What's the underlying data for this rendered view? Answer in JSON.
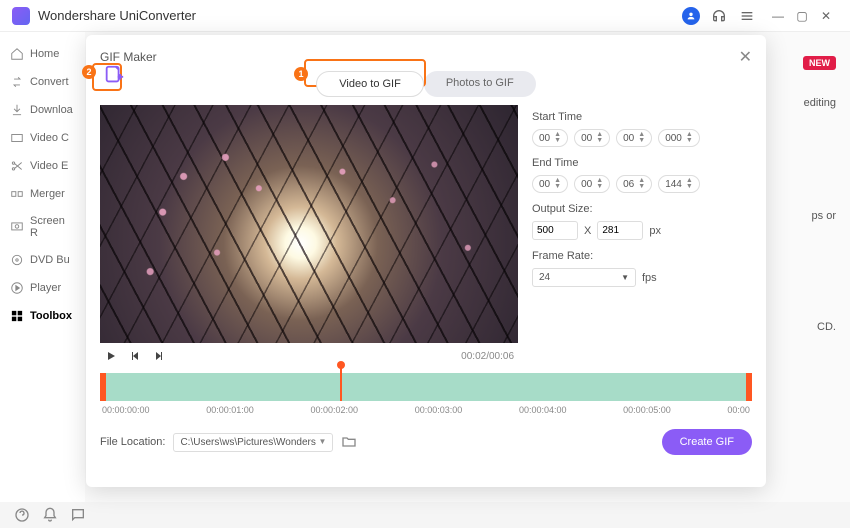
{
  "app": {
    "title": "Wondershare UniConverter"
  },
  "window_controls": {
    "min": "—",
    "max": "▢",
    "close": "✕"
  },
  "badge_new": "NEW",
  "bg_snippets": {
    "a": "editing",
    "b": "ps or",
    "c": "CD."
  },
  "sidebar": {
    "items": [
      {
        "label": "Home"
      },
      {
        "label": "Convert"
      },
      {
        "label": "Downloa"
      },
      {
        "label": "Video C"
      },
      {
        "label": "Video E"
      },
      {
        "label": "Merger"
      },
      {
        "label": "Screen R"
      },
      {
        "label": "DVD Bu"
      },
      {
        "label": "Player"
      },
      {
        "label": "Toolbox"
      }
    ]
  },
  "modal": {
    "title": "GIF Maker",
    "tabs": {
      "video": "Video to GIF",
      "photos": "Photos to GIF"
    },
    "player": {
      "time": "00:02/00:06"
    },
    "settings": {
      "start_label": "Start Time",
      "start": {
        "h": "00",
        "m": "00",
        "s": "00",
        "ms": "000"
      },
      "end_label": "End Time",
      "end": {
        "h": "00",
        "m": "00",
        "s": "06",
        "ms": "144"
      },
      "output_size_label": "Output Size:",
      "output_w": "500",
      "output_h": "281",
      "px": "px",
      "x": "X",
      "frame_rate_label": "Frame Rate:",
      "frame_rate": "24",
      "fps": "fps"
    },
    "timeline_ticks": [
      "00:00:00:00",
      "00:00:01:00",
      "00:00:02:00",
      "00:00:03:00",
      "00:00:04:00",
      "00:00:05:00",
      "00:00"
    ],
    "file_location_label": "File Location:",
    "file_location": "C:\\Users\\ws\\Pictures\\Wonders",
    "create_label": "Create GIF"
  },
  "annotations": {
    "one": "1",
    "two": "2"
  }
}
